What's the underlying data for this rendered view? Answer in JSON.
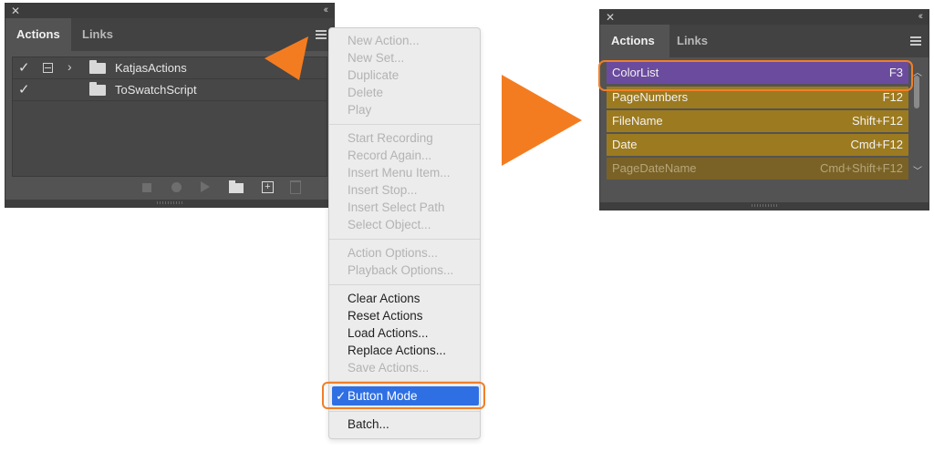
{
  "left_panel": {
    "tabs": [
      {
        "label": "Actions"
      },
      {
        "label": "Links"
      }
    ],
    "rows": [
      {
        "name": "KatjasActions",
        "expanded_icon": "chevron-right-icon"
      },
      {
        "name": "ToSwatchScript"
      }
    ]
  },
  "menu": {
    "group1": [
      "New Action...",
      "New Set...",
      "Duplicate",
      "Delete",
      "Play"
    ],
    "group2": [
      "Start Recording",
      "Record Again...",
      "Insert Menu Item...",
      "Insert Stop...",
      "Insert Select Path",
      "Select Object..."
    ],
    "group3": [
      "Action Options...",
      "Playback Options..."
    ],
    "group4": [
      "Clear Actions",
      "Reset Actions",
      "Load Actions...",
      "Replace Actions...",
      "Save Actions..."
    ],
    "button_mode": {
      "check": "✓",
      "label": "Button Mode"
    },
    "batch": "Batch..."
  },
  "right_panel": {
    "tabs": [
      {
        "label": "Actions"
      },
      {
        "label": "Links"
      }
    ],
    "buttons": [
      {
        "name": "ColorList",
        "key": "F3",
        "color": "#6b4b9e"
      },
      {
        "name": "PageNumbers",
        "key": "F12",
        "color": "#9c7a1f"
      },
      {
        "name": "FileName",
        "key": "Shift+F12",
        "color": "#9c7a1f"
      },
      {
        "name": "Date",
        "key": "Cmd+F12",
        "color": "#9c7a1f"
      },
      {
        "name": "PageDateName",
        "key": "Cmd+Shift+F12",
        "color": "#7a6226"
      }
    ]
  },
  "colors": {
    "accent_orange": "#f47c20",
    "menu_selected": "#2f6fe4"
  }
}
